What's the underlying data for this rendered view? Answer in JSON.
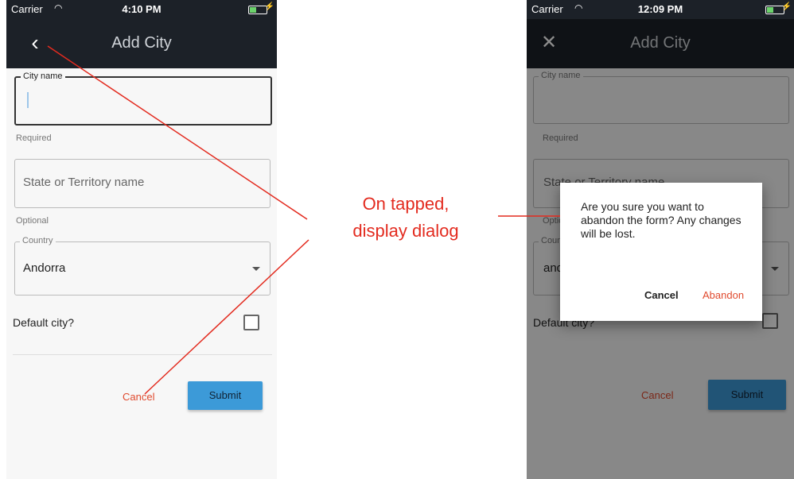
{
  "annotation": {
    "line1": "On tapped,",
    "line2": "display dialog",
    "color": "#e32b1f"
  },
  "left_screen": {
    "status": {
      "carrier": "Carrier",
      "time": "4:10 PM"
    },
    "nav": {
      "back_icon": "chevron-left-icon",
      "title": "Add City"
    },
    "form": {
      "city_legend": "City name",
      "city_helper": "Required",
      "state_placeholder": "State or Territory name",
      "state_helper": "Optional",
      "country_legend": "Country",
      "country_value": "Andorra",
      "default_label": "Default city?",
      "cancel_label": "Cancel",
      "submit_label": "Submit"
    }
  },
  "right_screen": {
    "status": {
      "carrier": "Carrier",
      "time": "12:09 PM"
    },
    "nav": {
      "close_icon": "close-icon",
      "title": "Add City"
    },
    "form": {
      "city_legend": "City name",
      "city_helper": "Required",
      "state_placeholder": "State or Territory name",
      "state_helper": "Optional",
      "country_legend": "Country",
      "country_value": "andorra",
      "default_label": "Default city?",
      "cancel_label": "Cancel",
      "submit_label": "Submit"
    },
    "dialog": {
      "message": "Are you sure you want to abandon the form? Any changes will be lost.",
      "cancel_label": "Cancel",
      "abandon_label": "Abandon"
    }
  },
  "colors": {
    "nav_bg": "#1c2128",
    "accent": "#3c9ad8",
    "danger": "#e04a2e"
  }
}
